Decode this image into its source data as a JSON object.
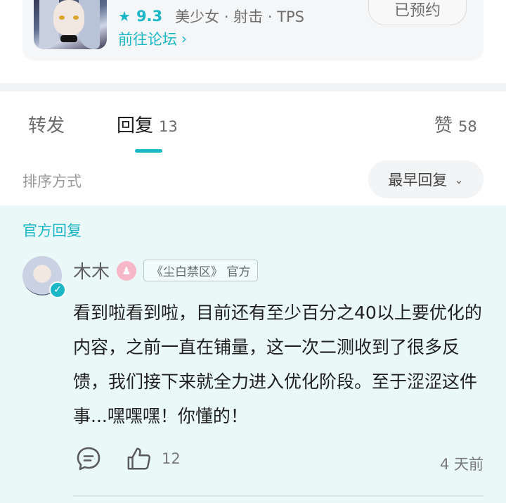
{
  "game": {
    "rating": "9.3",
    "tags": "美少女 · 射击 · TPS",
    "forum_link": "前往论坛",
    "reserved_label": "已预约"
  },
  "tabs": [
    {
      "label": "转发",
      "count": ""
    },
    {
      "label": "回复",
      "count": "13"
    },
    {
      "label": "赞",
      "count": "58"
    }
  ],
  "sort": {
    "label": "排序方式",
    "selected": "最早回复"
  },
  "official": {
    "title": "官方回复",
    "user": {
      "name": "木木",
      "badge": "《尘白禁区》 官方"
    },
    "content": "看到啦看到啦，目前还有至少百分之40以上要优化的内容，之前一直在铺量，这一次二测收到了很多反馈，我们接下来就全力进入优化阶段。至于涩涩这件事...嘿嘿嘿！你懂的！",
    "likes": "12",
    "time": "4 天前"
  },
  "colors": {
    "accent": "#1bb7c6",
    "official_bg": "#eaf8f8"
  },
  "icons": [
    "star-icon",
    "chevron-right-icon",
    "chevron-down-icon",
    "verified-icon",
    "comment-icon",
    "thumbs-up-icon"
  ]
}
